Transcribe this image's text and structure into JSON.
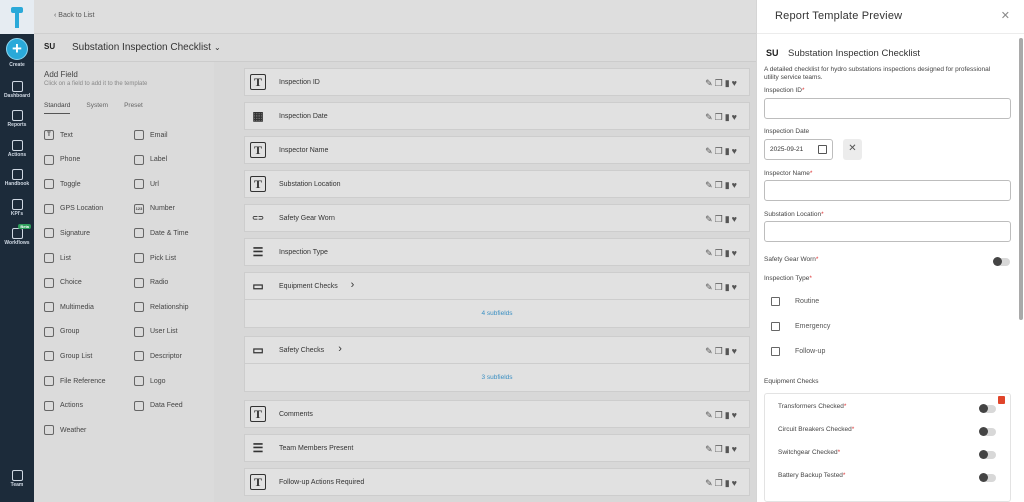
{
  "nav": {
    "items": [
      {
        "label": "Create",
        "icon": "plus-icon"
      },
      {
        "label": "Dashboard",
        "icon": "grid-icon"
      },
      {
        "label": "Reports",
        "icon": "layers-icon"
      },
      {
        "label": "Actions",
        "icon": "checklist-icon"
      },
      {
        "label": "Handbook",
        "icon": "book-icon"
      },
      {
        "label": "KPI's",
        "icon": "document-icon"
      },
      {
        "label": "Workflows",
        "icon": "workflow-icon"
      },
      {
        "label": "Team",
        "icon": "team-icon"
      }
    ],
    "beta_label": "Beta"
  },
  "topbar": {
    "back_label": "Back to List"
  },
  "document": {
    "badge": "SU",
    "title": "Substation Inspection Checklist"
  },
  "add_field": {
    "heading": "Add Field",
    "subtitle": "Click on a field to add it to the template",
    "tabs": [
      "Standard",
      "System",
      "Preset"
    ],
    "types": [
      [
        "Text",
        "Email"
      ],
      [
        "Phone",
        "Label"
      ],
      [
        "Toggle",
        "Url"
      ],
      [
        "GPS Location",
        "Number"
      ],
      [
        "Signature",
        "Date & Time"
      ],
      [
        "List",
        "Pick List"
      ],
      [
        "Choice",
        "Radio"
      ],
      [
        "Multimedia",
        "Relationship"
      ],
      [
        "Group",
        "User List"
      ],
      [
        "Group List",
        "Descriptor"
      ],
      [
        "File Reference",
        "Logo"
      ],
      [
        "Actions",
        "Data Feed"
      ],
      [
        "Weather",
        ""
      ]
    ],
    "number_icon_text": "123"
  },
  "fields": [
    {
      "label": "Inspection ID",
      "icon": "text-icon"
    },
    {
      "label": "Inspection Date",
      "icon": "calendar-icon"
    },
    {
      "label": "Inspector Name",
      "icon": "text-icon"
    },
    {
      "label": "Substation Location",
      "icon": "text-icon"
    },
    {
      "label": "Safety Gear Worn",
      "icon": "toggle-icon"
    },
    {
      "label": "Inspection Type",
      "icon": "list-icon"
    },
    {
      "label": "Equipment Checks",
      "icon": "group-icon",
      "subfields": "4 subfields"
    },
    {
      "label": "Safety Checks",
      "icon": "group-icon",
      "subfields": "3 subfields"
    },
    {
      "label": "Comments",
      "icon": "text-icon"
    },
    {
      "label": "Team Members Present",
      "icon": "list-icon"
    },
    {
      "label": "Follow-up Actions Required",
      "icon": "text-icon"
    }
  ],
  "preview": {
    "title": "Report Template Preview",
    "badge": "SU",
    "name": "Substation Inspection Checklist",
    "description": "A detailed checklist for hydro substations inspections designed for professional utility service teams.",
    "labels": {
      "inspection_id": "Inspection ID",
      "inspection_date": "Inspection Date",
      "inspector_name": "Inspector Name",
      "substation_location": "Substation Location",
      "safety_gear": "Safety Gear Worn",
      "inspection_type": "Inspection Type",
      "equipment_checks": "Equipment Checks"
    },
    "date_value": "2025-09-21",
    "inspection_types": [
      "Routine",
      "Emergency",
      "Follow-up"
    ],
    "equipment_items": [
      "Transformers Checked",
      "Circuit Breakers Checked",
      "Switchgear Checked",
      "Battery Backup Tested"
    ]
  },
  "colors": {
    "accent": "#2aa9d9",
    "nav_bg": "#1c2b3a",
    "required": "#dd3333",
    "subfield_link": "#3a8fc2"
  }
}
